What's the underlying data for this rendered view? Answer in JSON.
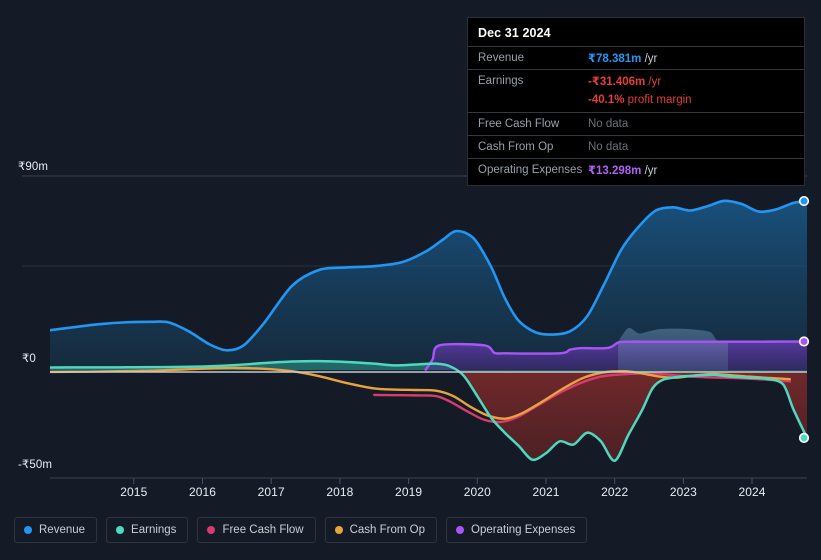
{
  "tooltip": {
    "date": "Dec 31 2024",
    "rows": [
      {
        "key": "Revenue",
        "value": "₹78.381m",
        "unit": " /yr",
        "style": "blue",
        "nodata": false
      },
      {
        "key": "Earnings",
        "value": "-₹31.406m",
        "unit": " /yr",
        "style": "red",
        "nodata": false
      },
      {
        "key": "",
        "value": "-40.1%",
        "unit": " profit margin",
        "style": "red",
        "nodata": false,
        "sub": true
      },
      {
        "key": "Free Cash Flow",
        "value": "No data",
        "unit": "",
        "style": "nodata",
        "nodata": true
      },
      {
        "key": "Cash From Op",
        "value": "No data",
        "unit": "",
        "style": "nodata",
        "nodata": true
      },
      {
        "key": "Operating Expenses",
        "value": "₹13.298m",
        "unit": " /yr",
        "style": "purple",
        "nodata": false
      }
    ]
  },
  "legend": {
    "items": [
      {
        "label": "Revenue",
        "color": "#2196f3"
      },
      {
        "label": "Earnings",
        "color": "#4dd9c0"
      },
      {
        "label": "Free Cash Flow",
        "color": "#d63c6e"
      },
      {
        "label": "Cash From Op",
        "color": "#e8a33d"
      },
      {
        "label": "Operating Expenses",
        "color": "#a855f7"
      }
    ]
  },
  "chart_data": {
    "type": "area",
    "title": "",
    "xlabel": "",
    "ylabel": "",
    "currency": "₹",
    "units": "m",
    "ylim": [
      -50,
      90
    ],
    "y_ticks": [
      {
        "value": 90,
        "label": "₹90m"
      },
      {
        "value": 45,
        "label": ""
      },
      {
        "value": 0,
        "label": "₹0"
      },
      {
        "value": -50,
        "label": "-₹50m"
      }
    ],
    "grid": true,
    "legend_position": "bottom",
    "x_ticks": [
      "2015",
      "2016",
      "2017",
      "2018",
      "2019",
      "2020",
      "2021",
      "2022",
      "2023",
      "2024"
    ],
    "x_range": [
      2014.28,
      2025.3
    ],
    "series": [
      {
        "name": "Revenue",
        "color": "#2196f3",
        "fill": true,
        "end_value": 78.381,
        "x": [
          2014.28,
          2014.6,
          2015.0,
          2015.4,
          2015.75,
          2016.0,
          2016.3,
          2016.6,
          2016.85,
          2017.1,
          2017.4,
          2017.8,
          2018.2,
          2018.6,
          2019.0,
          2019.4,
          2019.75,
          2020.0,
          2020.2,
          2020.45,
          2020.7,
          2020.9,
          2021.1,
          2021.35,
          2021.6,
          2021.85,
          2022.1,
          2022.35,
          2022.6,
          2022.85,
          2023.1,
          2023.35,
          2023.6,
          2023.85,
          2024.1,
          2024.35,
          2024.6,
          2024.85,
          2025.1,
          2025.3
        ],
        "values": [
          18.5,
          19.8,
          21.3,
          22.2,
          22.4,
          22.2,
          18.0,
          12.0,
          9.2,
          11.5,
          22.0,
          39.0,
          46.5,
          47.6,
          48.2,
          50.0,
          55.0,
          60.5,
          64.5,
          61.0,
          48.0,
          33.5,
          23.0,
          17.5,
          16.5,
          18.0,
          25.0,
          40.0,
          56.0,
          66.5,
          74.0,
          75.5,
          74.0,
          76.0,
          78.5,
          77.0,
          73.5,
          74.5,
          77.5,
          78.381
        ]
      },
      {
        "name": "Earnings",
        "color": "#4dd9c0",
        "fill": true,
        "end_value": -31.406,
        "x": [
          2014.28,
          2014.8,
          2015.3,
          2015.8,
          2016.2,
          2016.6,
          2017.0,
          2017.4,
          2017.8,
          2018.2,
          2018.6,
          2019.0,
          2019.3,
          2019.6,
          2019.9,
          2020.1,
          2020.3,
          2020.5,
          2020.7,
          2020.9,
          2021.1,
          2021.3,
          2021.5,
          2021.7,
          2021.9,
          2022.1,
          2022.3,
          2022.5,
          2022.7,
          2022.9,
          2023.05,
          2023.2,
          2023.45,
          2023.7,
          2023.95,
          2024.2,
          2024.45,
          2024.7,
          2024.95,
          2025.1,
          2025.3
        ],
        "values": [
          1.2,
          1.3,
          1.3,
          1.4,
          1.5,
          1.8,
          2.4,
          3.3,
          4.0,
          4.2,
          3.8,
          3.0,
          2.2,
          2.6,
          3.0,
          1.8,
          -2.5,
          -12.0,
          -22.0,
          -29.0,
          -35.0,
          -41.5,
          -38.5,
          -33.0,
          -34.5,
          -29.0,
          -33.0,
          -42.0,
          -30.0,
          -18.5,
          -8.5,
          -4.5,
          -3.0,
          -2.5,
          -2.2,
          -3.0,
          -3.5,
          -4.0,
          -6.5,
          -18.0,
          -31.406
        ]
      },
      {
        "name": "Free Cash Flow",
        "color": "#d63c6e",
        "fill": false,
        "end_value": null,
        "x": [
          2019.0,
          2019.3,
          2019.6,
          2019.9,
          2020.1,
          2020.35,
          2020.6,
          2020.85,
          2021.1,
          2021.4,
          2021.7,
          2022.0,
          2022.3,
          2022.6,
          2022.9,
          2023.1,
          2023.35,
          2023.6,
          2023.9,
          2024.2,
          2024.5,
          2024.8,
          2025.05
        ],
        "values": [
          -11.5,
          -11.6,
          -11.7,
          -12.0,
          -14.5,
          -19.0,
          -23.0,
          -24.0,
          -21.5,
          -16.0,
          -10.5,
          -6.0,
          -3.0,
          -2.0,
          -1.5,
          -1.6,
          -2.3,
          -3.0,
          -3.4,
          -3.6,
          -4.0,
          -4.6,
          -5.2
        ]
      },
      {
        "name": "Cash From Op",
        "color": "#e8a33d",
        "fill": false,
        "end_value": null,
        "x": [
          2014.28,
          2014.8,
          2015.3,
          2015.8,
          2016.2,
          2016.6,
          2017.0,
          2017.4,
          2017.8,
          2018.2,
          2018.6,
          2019.0,
          2019.3,
          2019.6,
          2019.9,
          2020.15,
          2020.4,
          2020.65,
          2020.9,
          2021.15,
          2021.45,
          2021.75,
          2022.05,
          2022.35,
          2022.65,
          2022.9,
          2023.15,
          2023.4,
          2023.65,
          2023.9,
          2024.15,
          2024.45,
          2024.75,
          2025.05
        ],
        "values": [
          -0.8,
          -0.7,
          -0.5,
          -0.2,
          0.3,
          0.8,
          1.0,
          0.6,
          -0.5,
          -2.8,
          -6.0,
          -8.5,
          -9.0,
          -9.2,
          -9.5,
          -12.0,
          -17.0,
          -21.0,
          -22.5,
          -20.0,
          -14.5,
          -8.5,
          -3.5,
          -1.0,
          -0.5,
          -1.5,
          -3.0,
          -3.5,
          -2.5,
          -1.8,
          -2.2,
          -3.0,
          -3.6,
          -4.2
        ]
      },
      {
        "name": "Operating Expenses",
        "color": "#a855f7",
        "fill": true,
        "end_value": 13.298,
        "x": [
          2019.75,
          2019.85,
          2019.95,
          2020.6,
          2020.75,
          2020.9,
          2021.7,
          2021.85,
          2022.0,
          2022.4,
          2022.55,
          2022.7,
          2023.0,
          2023.4,
          2023.8,
          2024.2,
          2024.6,
          2025.0,
          2025.3
        ],
        "values": [
          0.2,
          5.0,
          11.5,
          11.5,
          8.0,
          7.8,
          7.8,
          9.5,
          10.2,
          10.3,
          12.8,
          13.2,
          13.2,
          13.2,
          13.2,
          13.2,
          13.2,
          13.25,
          13.298
        ]
      },
      {
        "name": "Revenue Secondary Band",
        "color": "#7da4c9",
        "fill": true,
        "end_value": null,
        "x": [
          2022.55,
          2022.7,
          2022.85,
          2023.0,
          2023.15,
          2023.3,
          2023.45,
          2023.6,
          2023.75,
          2023.9,
          2024.0,
          2024.15
        ],
        "values": [
          13.2,
          19.5,
          17.0,
          18.0,
          19.0,
          19.2,
          19.2,
          19.0,
          18.5,
          17.5,
          13.5,
          13.2
        ]
      }
    ],
    "end_markers": [
      {
        "series": "Revenue",
        "value": 78.381,
        "color": "#2196f3"
      },
      {
        "series": "Operating Expenses",
        "value": 13.298,
        "color": "#a855f7"
      },
      {
        "series": "Earnings",
        "value": -31.406,
        "color": "#4dd9c0"
      }
    ]
  }
}
